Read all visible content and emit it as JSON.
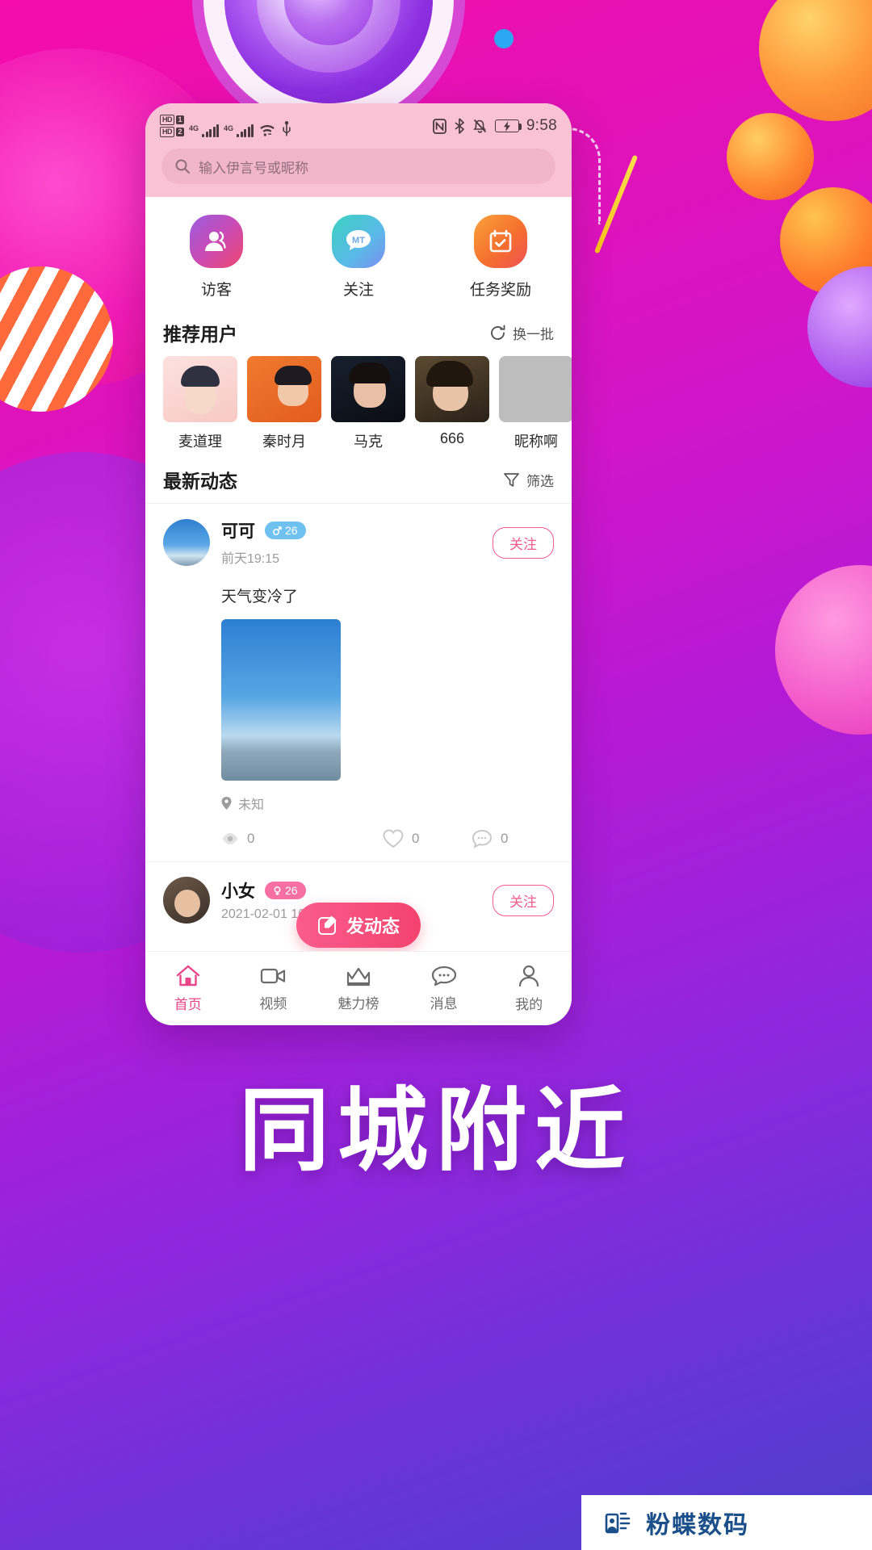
{
  "statusbar": {
    "hd_label_1": "HD",
    "sim_1": "1",
    "hd_label_2": "HD",
    "sim_2": "2",
    "net_1": "4G",
    "net_2": "4G",
    "icons": [
      "wifi-icon",
      "usb-icon",
      "nfc-icon",
      "bluetooth-icon",
      "bell-muted-icon",
      "battery-charging-icon"
    ],
    "clock": "9:58"
  },
  "search": {
    "placeholder": "输入伊言号或昵称",
    "icon": "search-icon"
  },
  "shortcuts": [
    {
      "label": "访客",
      "icon": "visitor-icon"
    },
    {
      "label": "关注",
      "icon": "follow-chat-icon"
    },
    {
      "label": "任务奖励",
      "icon": "task-reward-icon"
    }
  ],
  "recommend": {
    "title": "推荐用户",
    "refresh_label": "换一批",
    "refresh_icon": "refresh-icon",
    "users": [
      {
        "name": "麦道理"
      },
      {
        "name": "秦时月"
      },
      {
        "name": "马克"
      },
      {
        "name": "666"
      },
      {
        "name": "昵称啊"
      }
    ]
  },
  "feed": {
    "title": "最新动态",
    "filter_label": "筛选",
    "filter_icon": "filter-icon",
    "posts": [
      {
        "name": "可可",
        "gender_icon": "male-icon",
        "age": "26",
        "time": "前天19:15",
        "follow_label": "关注",
        "text": "天气变冷了",
        "location": "未知",
        "location_icon": "location-pin-icon",
        "views": "0",
        "views_icon": "eye-icon",
        "likes": "0",
        "likes_icon": "heart-icon",
        "comments": "0",
        "comments_icon": "comment-icon"
      },
      {
        "name": "小女",
        "gender_icon": "female-icon",
        "age": "26",
        "time": "2021-02-01 16:25",
        "follow_label": "关注"
      }
    ]
  },
  "fab": {
    "label": "发动态",
    "icon": "pencil-edit-icon"
  },
  "bottomnav": [
    {
      "label": "首页",
      "icon": "home-icon",
      "active": true
    },
    {
      "label": "视频",
      "icon": "video-icon",
      "active": false
    },
    {
      "label": "魅力榜",
      "icon": "crown-icon",
      "active": false
    },
    {
      "label": "消息",
      "icon": "message-icon",
      "active": false
    },
    {
      "label": "我的",
      "icon": "person-icon",
      "active": false
    }
  ],
  "headline": "同城附近",
  "watermark": {
    "text": "粉蝶数码",
    "icon": "butterfly-logo-icon"
  },
  "colors": {
    "accent_pink": "#f3436f",
    "nav_active": "#e8458a",
    "badge_male": "#6fc2f0",
    "badge_female": "#f76fa3",
    "statusbar_bg": "#f9c3d5"
  }
}
